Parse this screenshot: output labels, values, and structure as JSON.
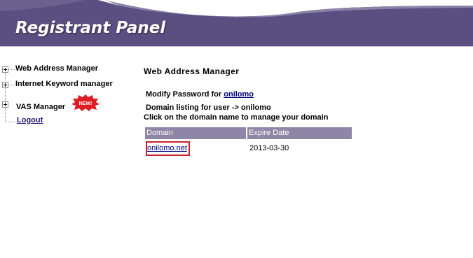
{
  "header": {
    "title": "Registrant Panel"
  },
  "sidebar": {
    "items": [
      {
        "label": "Web Address Manager"
      },
      {
        "label": "Internet Keyword manager"
      },
      {
        "label": "VAS Manager",
        "badge": "NEW!"
      }
    ],
    "logout_label": "Logout"
  },
  "main": {
    "title": "Web Address Manager",
    "modify_prefix": "Modify Password for ",
    "modify_user": "onilomo",
    "listing_text": "Domain listing for user -> onilomo",
    "instruction": "Click on the domain name to manage your domain",
    "table": {
      "columns": [
        "Domain",
        "Expire Date"
      ],
      "rows": [
        {
          "domain": "onilomo.net",
          "expire": "2013-03-30"
        }
      ]
    }
  },
  "colors": {
    "header_bg": "#5a4f80",
    "table_header_bg": "#8e86a6",
    "link": "#000080",
    "highlight_border": "#cc1f2a",
    "badge_red": "#e01b24"
  }
}
